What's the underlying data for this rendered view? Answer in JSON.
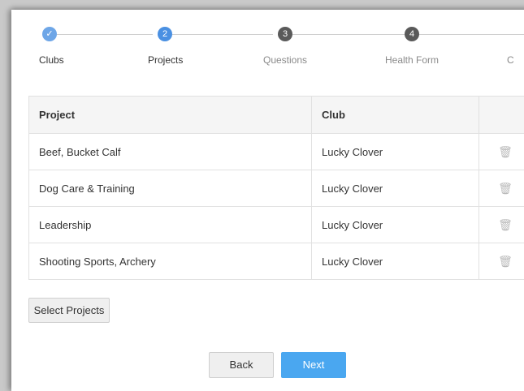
{
  "stepper": {
    "steps": [
      {
        "label": "Clubs",
        "number": "",
        "state": "done"
      },
      {
        "label": "Projects",
        "number": "2",
        "state": "active"
      },
      {
        "label": "Questions",
        "number": "3",
        "state": "todo"
      },
      {
        "label": "Health Form",
        "number": "4",
        "state": "todo"
      },
      {
        "label": "C",
        "number": "",
        "state": "todo"
      }
    ],
    "check_glyph": "✓"
  },
  "table": {
    "headers": {
      "project": "Project",
      "club": "Club",
      "action": ""
    },
    "rows": [
      {
        "project": "Beef, Bucket Calf",
        "club": "Lucky Clover"
      },
      {
        "project": "Dog Care & Training",
        "club": "Lucky Clover"
      },
      {
        "project": "Leadership",
        "club": "Lucky Clover"
      },
      {
        "project": "Shooting Sports, Archery",
        "club": "Lucky Clover"
      }
    ],
    "delete_icon": "trash-icon"
  },
  "buttons": {
    "select_projects": "Select Projects",
    "back": "Back",
    "next": "Next"
  },
  "colors": {
    "accent": "#4a90e2",
    "primary_button": "#4aa7f0",
    "pending_step": "#5a5a5a"
  }
}
